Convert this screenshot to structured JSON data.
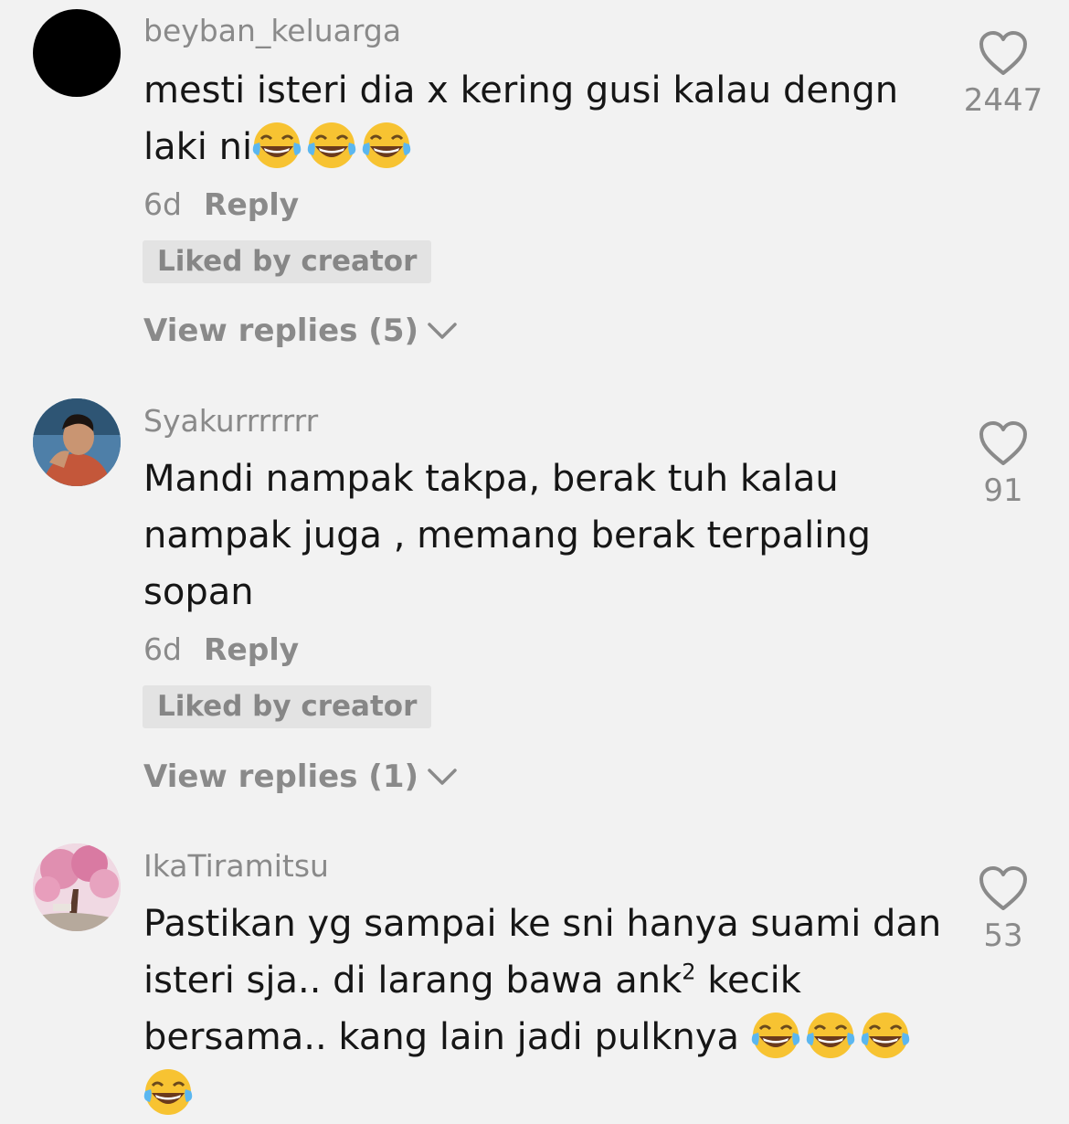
{
  "comments": [
    {
      "username": "beyban_keluarga",
      "text_line1": "mesti isteri dia x kering gusi kalau dengn",
      "text_line2": "laki ni",
      "emoji_trailing": [
        "laughing-tears",
        "laughing-tears",
        "laughing-tears"
      ],
      "time": "6d",
      "reply_label": "Reply",
      "liked_badge": "Liked by creator",
      "view_replies": "View replies (5)",
      "likes": "2447"
    },
    {
      "username": "Syakurrrrrrr",
      "text_line1": "Mandi nampak takpa, berak tuh kalau",
      "text_line2": "nampak juga , memang berak terpaling",
      "text_line3": "sopan",
      "time": "6d",
      "reply_label": "Reply",
      "liked_badge": "Liked by creator",
      "view_replies": "View replies (1)",
      "likes": "91"
    },
    {
      "username": "IkaTiramitsu",
      "text_line1": "Pastikan yg sampai ke sni hanya suami dan",
      "text_line2_a": "isteri sja.. di larang bawa ank",
      "text_line2_sup": "2",
      "text_line2_b": " kecik",
      "text_line3": "bersama.. kang lain jadi pulknya ",
      "emoji_trailing": [
        "laughing-tears",
        "laughing-tears",
        "laughing-tears",
        "laughing-tears"
      ],
      "likes": "53"
    }
  ],
  "colors": {
    "background": "#f2f2f2",
    "text": "#161616",
    "muted": "#8a8a8a",
    "badge_bg": "#e3e3e3"
  }
}
